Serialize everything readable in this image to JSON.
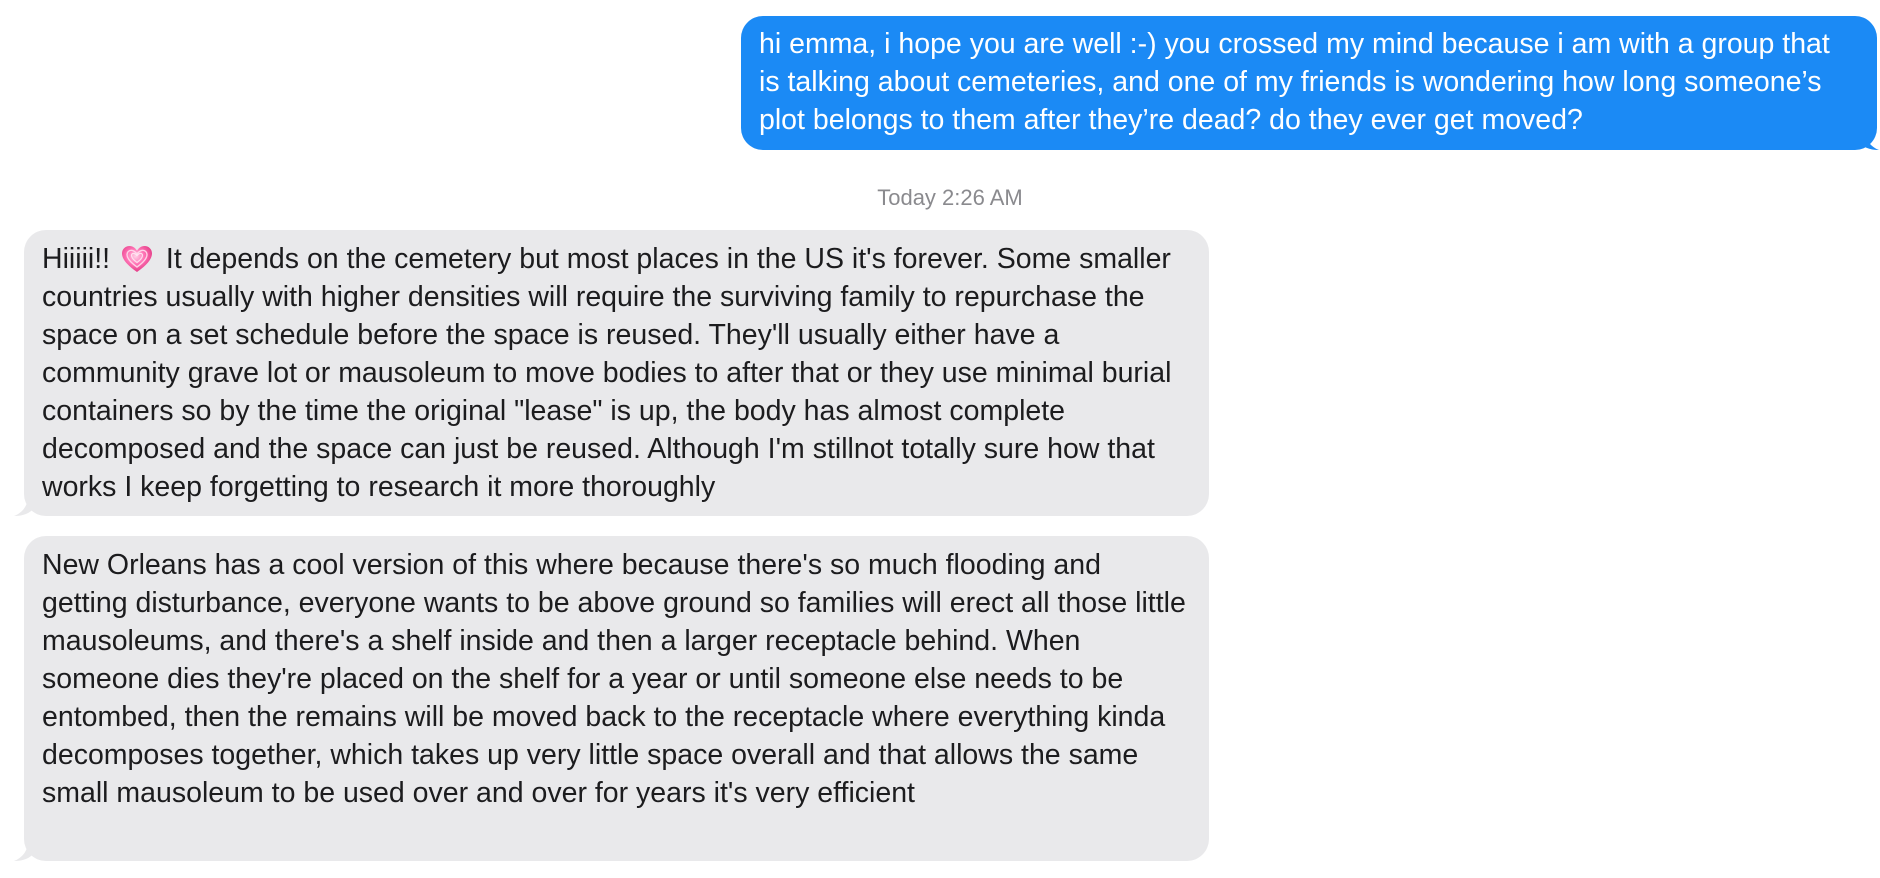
{
  "conversation": {
    "messages": [
      {
        "direction": "sent",
        "text": "hi emma, i hope you are well :-) you crossed my mind because i am with a group that is talking about cemeteries, and one of my friends is wondering how long someone’s plot belongs to them after they’re dead? do they ever get moved?"
      },
      {
        "direction": "received",
        "text_before_emoji": "Hiiiii!!",
        "emoji": "sparkling-heart-icon",
        "text_after_emoji": "It depends on the cemetery but most places in the US it's forever. Some smaller countries usually with higher densities will require the surviving family to repurchase the space on a set schedule before the space is reused. They'll usually either have a community grave lot or mausoleum to move bodies to after that or they use minimal burial containers so by the time the original \"lease\" is up, the body has almost complete decomposed and the space can just be reused. Although I'm stillnot totally sure how that works I keep forgetting to research it more thoroughly"
      },
      {
        "direction": "received",
        "text": "New Orleans has a cool version of this where because there's so much flooding and getting disturbance, everyone wants to be above ground so families will erect all those little mausoleums, and there's a shelf inside and then a larger receptacle behind. When someone dies they're placed on the shelf for a year or until someone else needs to be entombed, then the remains will be moved back to the receptacle where everything kinda decomposes together, which takes up very little space overall and that allows the same small mausoleum to be used over and over for years it's very efficient"
      }
    ],
    "timestamp": "Today 2:26 AM"
  },
  "colors": {
    "sent_bubble": "#1b8af5",
    "received_bubble": "#e9e9eb",
    "timestamp_text": "#8a8a8e"
  }
}
